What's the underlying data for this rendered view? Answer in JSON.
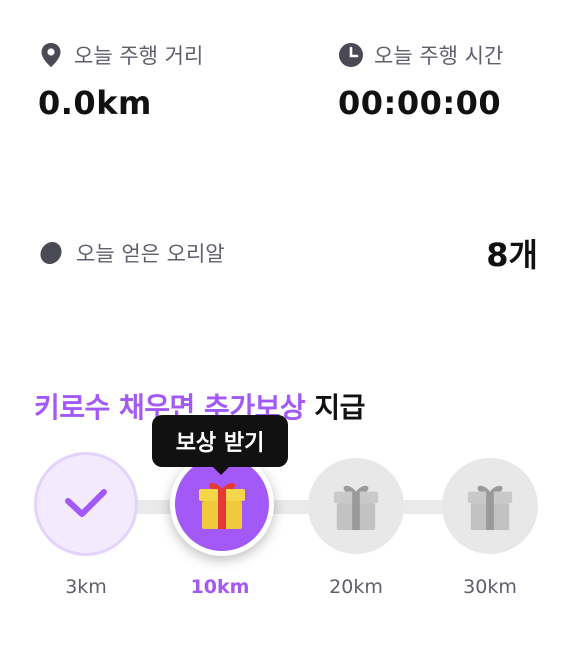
{
  "stats": {
    "distance": {
      "label": "오늘 주행 거리",
      "value": "0.0km",
      "icon": "location-pin-icon"
    },
    "time": {
      "label": "오늘 주행 시간",
      "value": "00:00:00",
      "icon": "clock-icon"
    },
    "eggs": {
      "label": "오늘 얻은 오리알",
      "value": "8개",
      "icon": "egg-icon"
    }
  },
  "headline": {
    "accent": "키로수 채우면 추가보상",
    "normal": "지급"
  },
  "tooltip": "보상 받기",
  "milestones": [
    {
      "km": "3km",
      "state": "completed",
      "icon": "check-icon"
    },
    {
      "km": "10km",
      "state": "claimable",
      "icon": "gift-icon"
    },
    {
      "km": "20km",
      "state": "locked",
      "icon": "gift-icon"
    },
    {
      "km": "30km",
      "state": "locked",
      "icon": "gift-icon"
    }
  ],
  "colors": {
    "accent": "#a259f7",
    "text": "#111111",
    "muted": "#5f5f6b",
    "locked": "#e8e8e8",
    "gift_yellow": "#f5d54a",
    "gift_red": "#e53935"
  }
}
